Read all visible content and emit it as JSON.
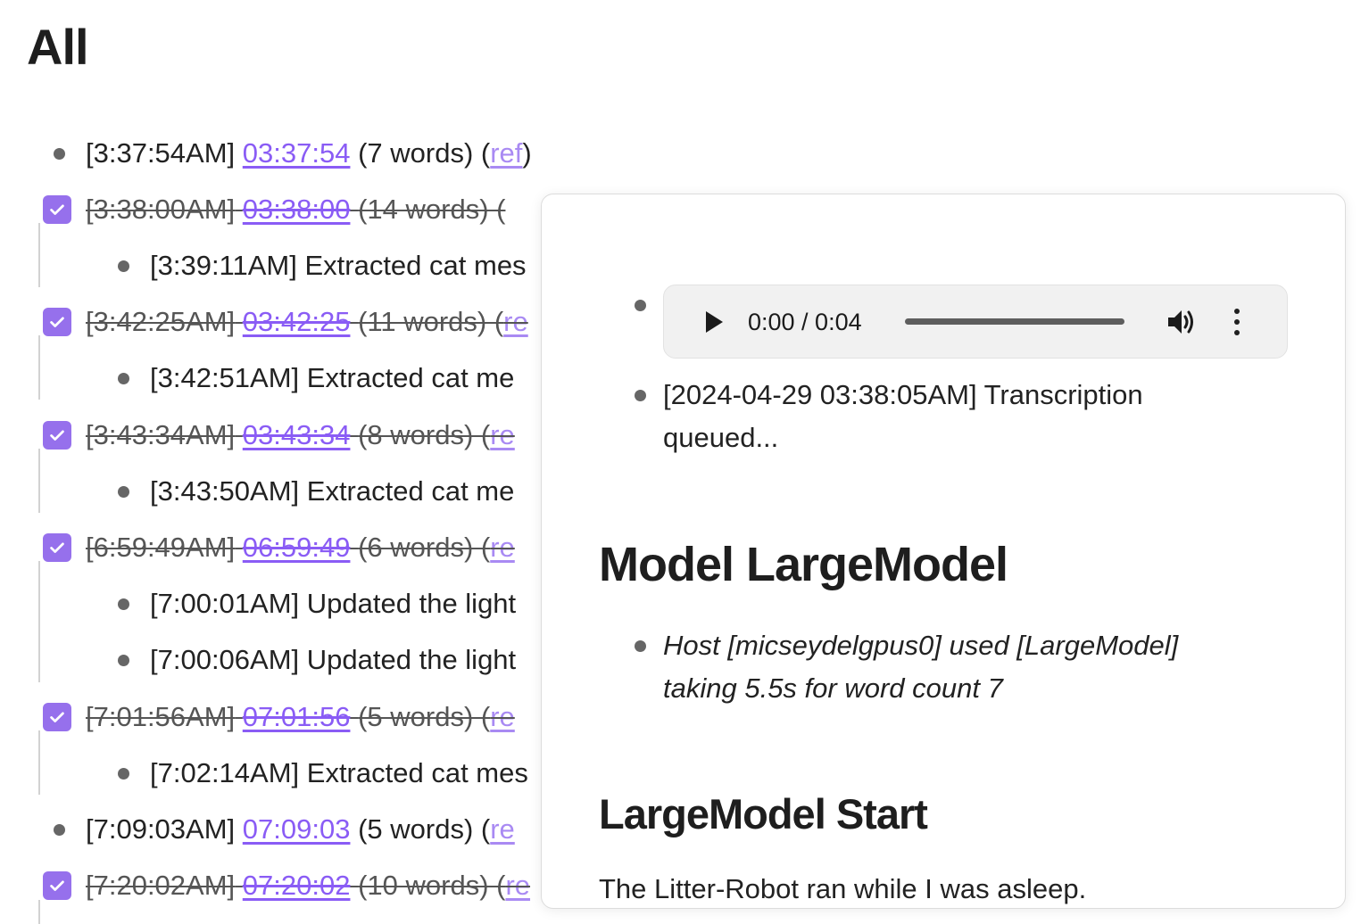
{
  "page": {
    "title": "All"
  },
  "entries": [
    {
      "time": "[3:37:54AM]",
      "link": "03:37:54",
      "words": "(7 words) (",
      "ref": "ref",
      "close": ")",
      "done": false
    },
    {
      "time": "[3:38:00AM]",
      "link": "03:38:00",
      "words": "(14 words) (",
      "done": true,
      "children": [
        "[3:39:11AM] Extracted cat mes"
      ]
    },
    {
      "time": "[3:42:25AM]",
      "link": "03:42:25",
      "words": "(11 words) (",
      "ref": "re",
      "done": true,
      "children": [
        "[3:42:51AM] Extracted cat me"
      ]
    },
    {
      "time": "[3:43:34AM]",
      "link": "03:43:34",
      "words": "(8 words) (",
      "ref": "re",
      "done": true,
      "children": [
        "[3:43:50AM] Extracted cat me"
      ]
    },
    {
      "time": "[6:59:49AM]",
      "link": "06:59:49",
      "words": "(6 words) (",
      "ref": "re",
      "done": true,
      "children": [
        "[7:00:01AM] Updated the light",
        "[7:00:06AM] Updated the light"
      ]
    },
    {
      "time": "[7:01:56AM]",
      "link": "07:01:56",
      "words": "(5 words) (",
      "ref": "re",
      "done": true,
      "children": [
        "[7:02:14AM] Extracted cat mes"
      ]
    },
    {
      "time": "[7:09:03AM]",
      "link": "07:09:03",
      "words": "(5 words) (",
      "ref": "re",
      "done": false
    },
    {
      "time": "[7:20:02AM]",
      "link": "07:20:02",
      "words": "(10 words) (",
      "ref": "re",
      "done": true
    }
  ],
  "popover": {
    "audio": {
      "time": "0:00 / 0:04",
      "icons": [
        "play-icon",
        "volume-icon",
        "more-vert-icon"
      ]
    },
    "transcription_line1": "[2024-04-29 03:38:05AM] Transcription",
    "transcription_line2": "queued...",
    "model_heading": "Model LargeModel",
    "host_line1": "Host [micseydelgpus0] used [LargeModel]",
    "host_line2": "taking 5.5s for word count 7",
    "start_heading": "LargeModel Start",
    "body_text": "The Litter-Robot ran while I was asleep."
  },
  "colors": {
    "accent": "#9670ec",
    "link": "#8a5cf5",
    "ref": "#a98af3",
    "text": "#222222"
  }
}
